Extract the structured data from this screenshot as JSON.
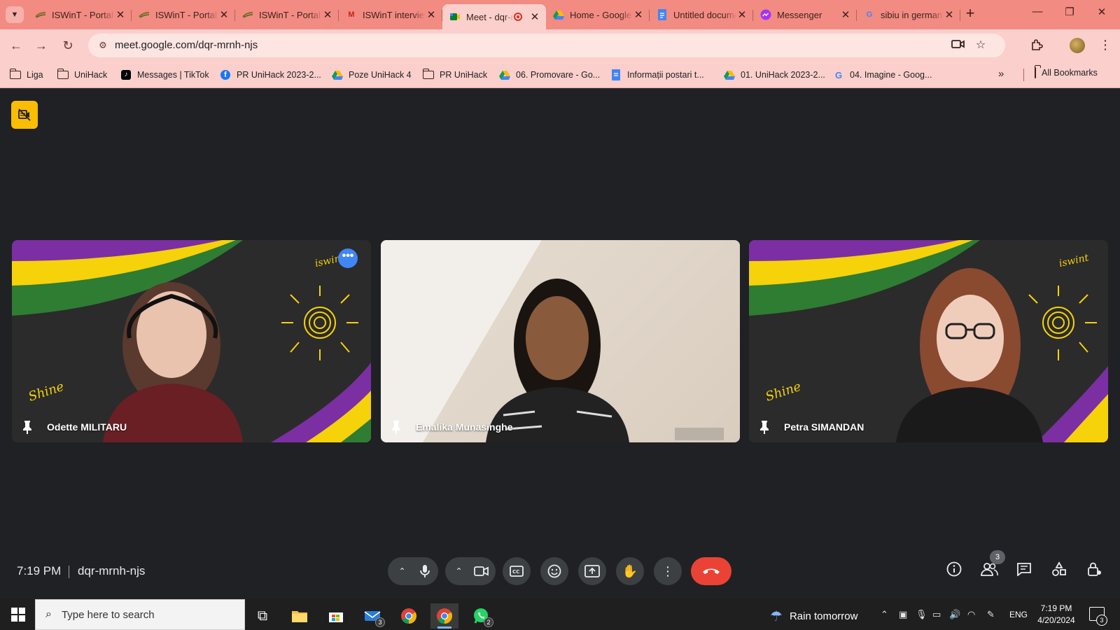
{
  "browser": {
    "tabs": [
      {
        "title": "ISWinT - Portal",
        "favicon": "iswint-icon",
        "active": false
      },
      {
        "title": "ISWinT - Portal",
        "favicon": "iswint-icon",
        "active": false
      },
      {
        "title": "ISWinT - Portal",
        "favicon": "iswint-icon",
        "active": false
      },
      {
        "title": "ISWinT interview",
        "favicon": "gmail-icon",
        "active": false
      },
      {
        "title": "Meet - dqr-mrnh-njs",
        "favicon": "meet-icon",
        "active": true,
        "recording": true
      },
      {
        "title": "Home - Google Drive",
        "favicon": "drive-icon",
        "active": false
      },
      {
        "title": "Untitled document",
        "favicon": "docs-icon",
        "active": false
      },
      {
        "title": "Messenger",
        "favicon": "messenger-icon",
        "active": false
      },
      {
        "title": "sibiu in german",
        "favicon": "google-icon",
        "active": false
      }
    ],
    "url": "meet.google.com/dqr-mrnh-njs",
    "bookmarks": [
      {
        "label": "Liga",
        "icon": "folder-icon"
      },
      {
        "label": "UniHack",
        "icon": "folder-icon"
      },
      {
        "label": "Messages | TikTok",
        "icon": "tiktok-icon"
      },
      {
        "label": "PR UniHack 2023-2...",
        "icon": "facebook-icon"
      },
      {
        "label": "Poze UniHack 4",
        "icon": "drive-icon"
      },
      {
        "label": "PR UniHack",
        "icon": "folder-icon"
      },
      {
        "label": "06. Promovare - Go...",
        "icon": "drive-icon"
      },
      {
        "label": "Informații postari t...",
        "icon": "docs-icon"
      },
      {
        "label": "01. UniHack 2023-2...",
        "icon": "drive-icon"
      },
      {
        "label": "04. Imagine - Goog...",
        "icon": "google-icon"
      }
    ],
    "all_bookmarks_label": "All Bookmarks"
  },
  "meet": {
    "participants": [
      {
        "name": "Odette MILITARU",
        "background": "iswint-branded"
      },
      {
        "name": "Emalika Munasinghe",
        "background": "room"
      },
      {
        "name": "Petra SIMANDAN",
        "background": "iswint-branded"
      }
    ],
    "time": "7:19 PM",
    "meeting_code": "dqr-mrnh-njs",
    "people_count": "3",
    "hangup_color": "#ea4335",
    "recording_badge_color": "#fbbc04"
  },
  "taskbar": {
    "search_placeholder": "Type here to search",
    "mail_badge": "3",
    "whatsapp_badge": "2",
    "weather": "Rain tomorrow",
    "language": "ENG",
    "time": "7:19 PM",
    "date": "4/20/2024",
    "notifications": "3"
  },
  "colors": {
    "tabstrip": "#f28b82",
    "toolbar": "#fbcfcb",
    "meet_bg": "#202124",
    "brand_purple": "#7b2fa3",
    "brand_yellow": "#f5d20a",
    "brand_green": "#2e7d32"
  }
}
